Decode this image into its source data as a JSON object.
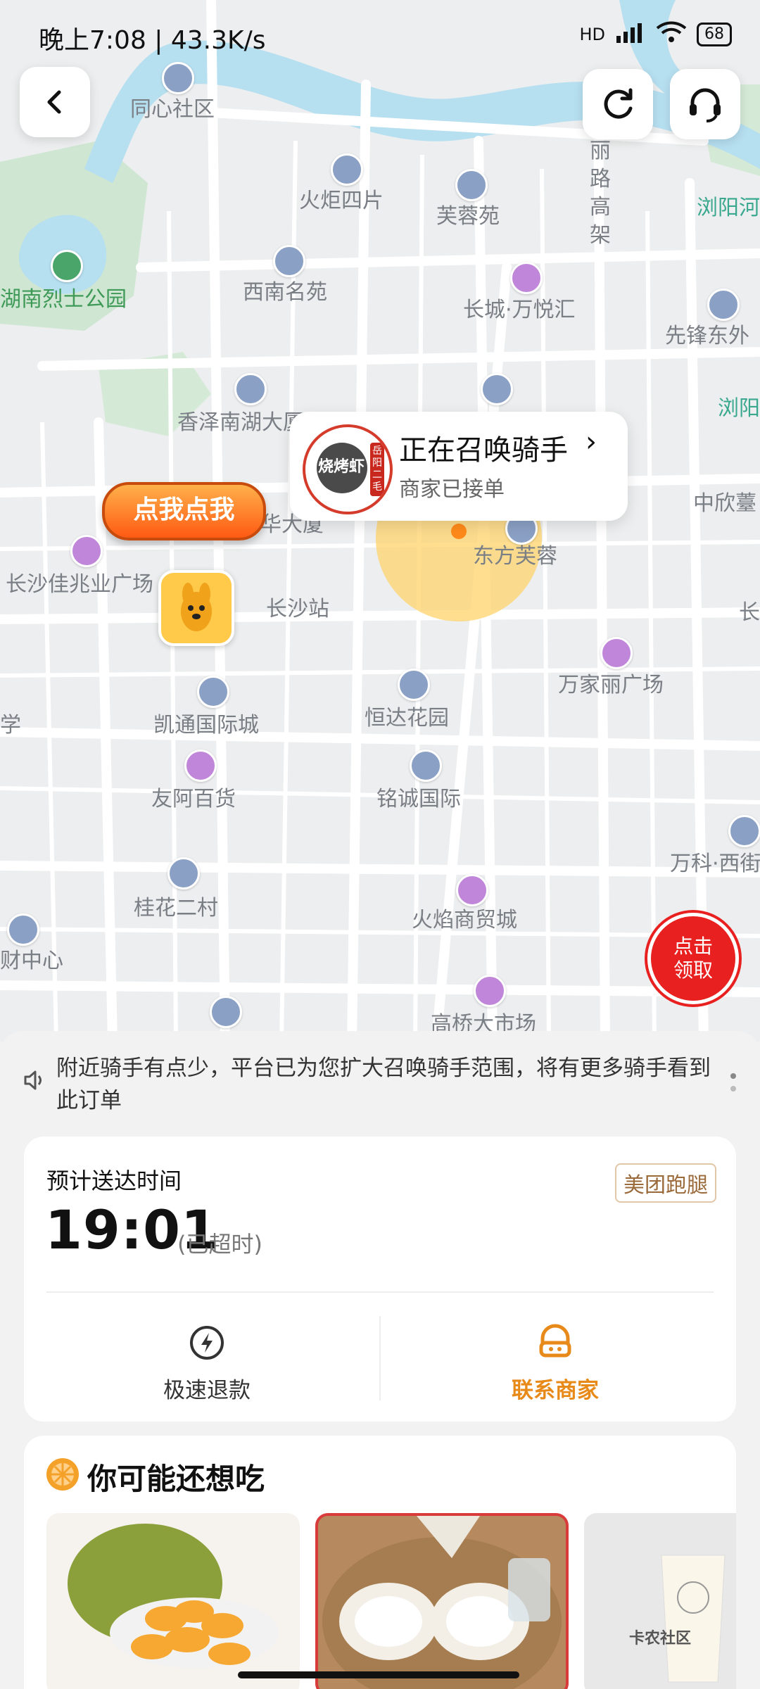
{
  "status_bar": {
    "time": "晚上7:08 | 43.3K/s",
    "network": "HD",
    "battery": "68"
  },
  "map": {
    "pois": [
      {
        "label": "同心社区"
      },
      {
        "label": "火炬四片"
      },
      {
        "label": "芙蓉苑"
      },
      {
        "label": "丽路高架"
      },
      {
        "label": "浏阳河"
      },
      {
        "label": "湖南烈士公园"
      },
      {
        "label": "西南名苑"
      },
      {
        "label": "长城·万悦汇"
      },
      {
        "label": "先锋东外"
      },
      {
        "label": "浏阳"
      },
      {
        "label": "香泽南湖大厦"
      },
      {
        "label": "中欣薹"
      },
      {
        "label": "华大厦"
      },
      {
        "label": "东方芙蓉"
      },
      {
        "label": "长沙佳兆业广场"
      },
      {
        "label": "长沙站"
      },
      {
        "label": "长"
      },
      {
        "label": "万家丽广场"
      },
      {
        "label": "凯通国际城"
      },
      {
        "label": "恒达花园"
      },
      {
        "label": "友阿百货"
      },
      {
        "label": "铭诚国际"
      },
      {
        "label": "万科·西街"
      },
      {
        "label": "桂花二村"
      },
      {
        "label": "火焰商贸城"
      },
      {
        "label": "财中心"
      },
      {
        "label": "高桥大市场"
      },
      {
        "label": "学"
      }
    ],
    "callout": {
      "title": "正在召唤骑手",
      "subtitle": "商家已接单",
      "logo_text": "烧烤虾",
      "logo_side_text": "岳阳二毛"
    },
    "promo_button": "点我点我",
    "badge": {
      "line1": "点击",
      "line2": "领取"
    }
  },
  "notice": {
    "text": "附近骑手有点少，平台已为您扩大召唤骑手范围，将有更多骑手看到此订单"
  },
  "delivery": {
    "eta_label": "预计送达时间",
    "courier_tag": "美团跑腿",
    "eta_time": "19:01",
    "eta_note": "(已超时)",
    "actions": [
      {
        "label": "极速退款",
        "icon": "lightning-icon"
      },
      {
        "label": "联系商家",
        "icon": "merchant-icon"
      }
    ]
  },
  "recommend": {
    "title": "你可能还想吃",
    "items": [
      {
        "name": "jackfruit"
      },
      {
        "name": "coconut"
      },
      {
        "name": "drink"
      }
    ]
  },
  "watermark": "卡农社区",
  "colors": {
    "accent": "#e88a1a",
    "river": "#b6dff0",
    "park": "#cfe6d2",
    "badge": "#e82020"
  }
}
